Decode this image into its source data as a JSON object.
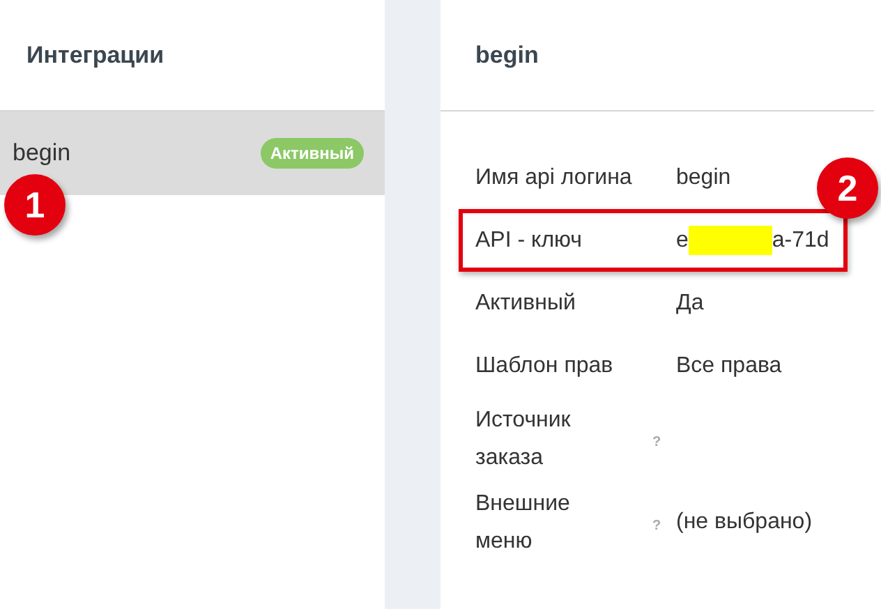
{
  "sidebar": {
    "title": "Интеграции",
    "items": [
      {
        "name": "begin",
        "badge": "Активный",
        "selected": true,
        "callout": "1"
      }
    ]
  },
  "detail": {
    "title": "begin",
    "fields": [
      {
        "label": "Имя api логина",
        "value": "begin"
      },
      {
        "label": "API - ключ",
        "value": "e",
        "redacted": true,
        "value_after_redaction": "a-71d",
        "highlighted": true,
        "callout": "2"
      },
      {
        "label": "Активный",
        "value": "Да"
      },
      {
        "label": "Шаблон прав",
        "value": "Все права"
      },
      {
        "label": "Источник заказа",
        "help_text": "?"
      },
      {
        "label": "Внешние меню",
        "value": "(не выбрано)",
        "help_text": "?"
      }
    ]
  }
}
